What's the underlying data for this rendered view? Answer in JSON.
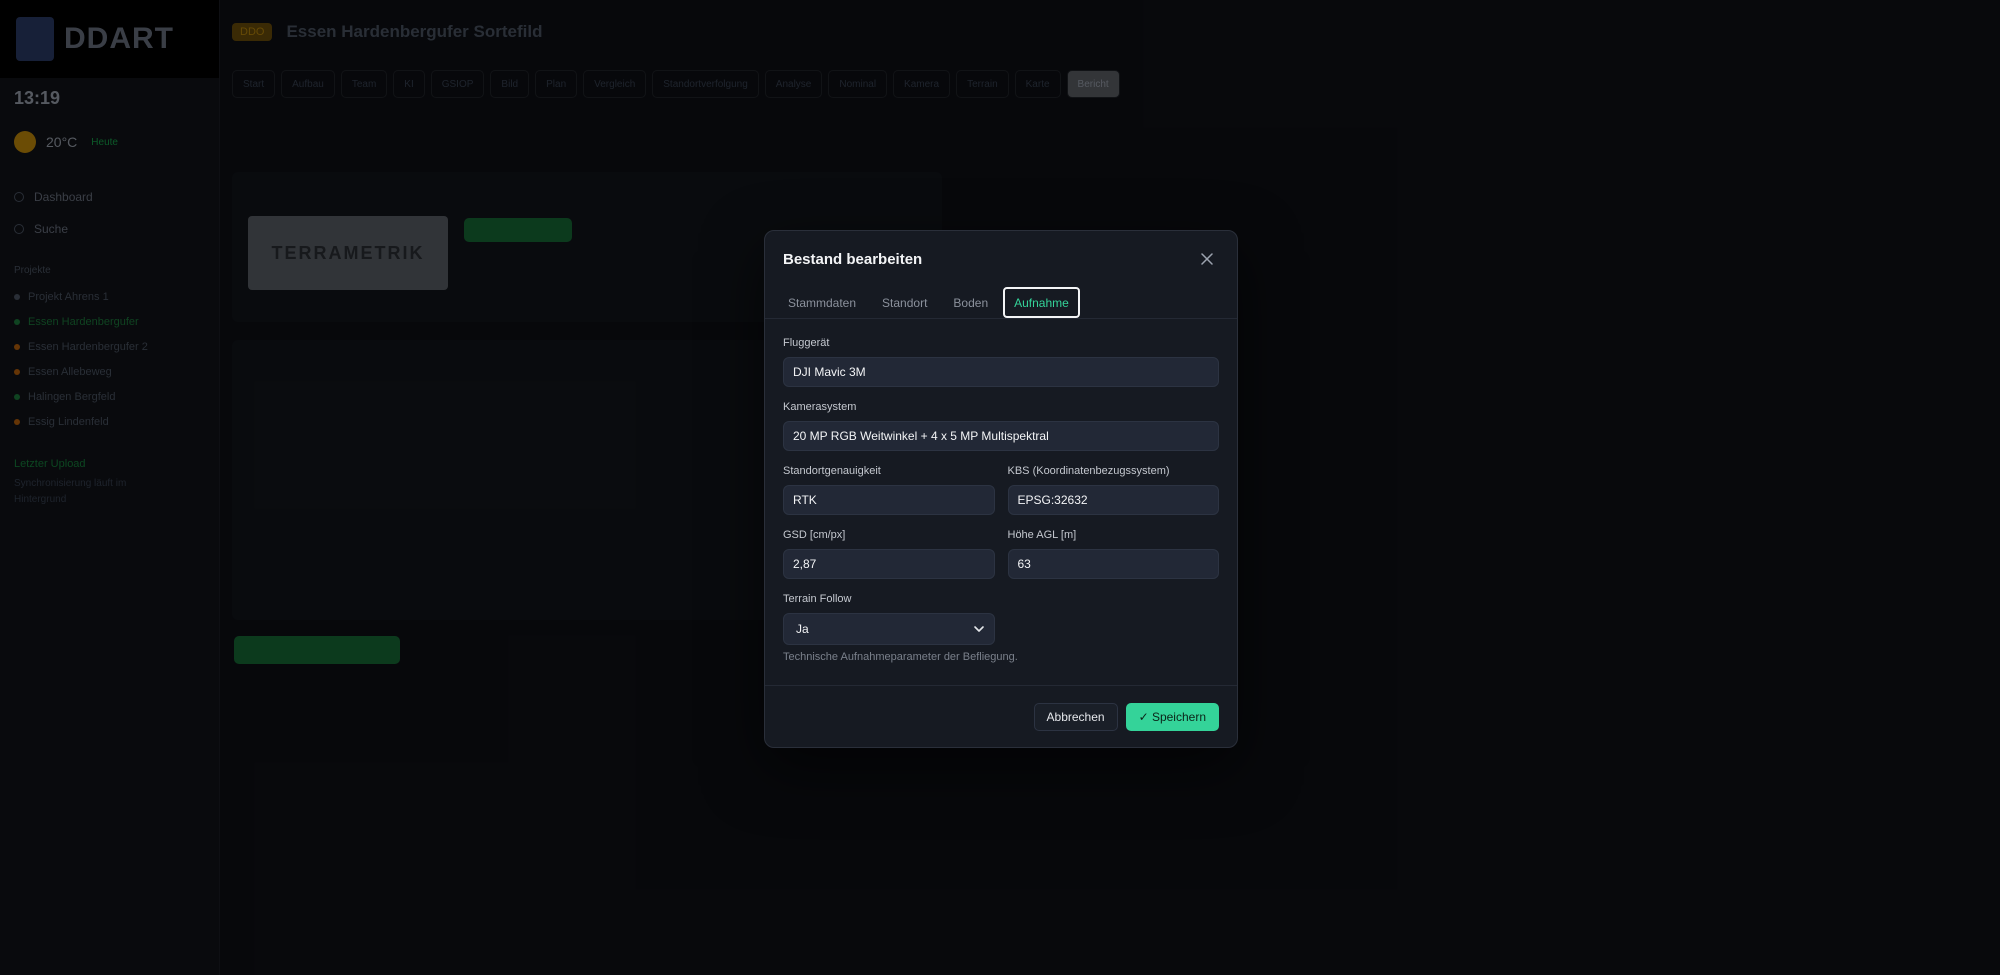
{
  "sidebar": {
    "brand": "DDART",
    "clock": "13:19",
    "weather": {
      "temp": "20°C",
      "sub": "Heute"
    },
    "nav": [
      "Dashboard",
      "Suche"
    ],
    "section": "Projekte",
    "projects": [
      {
        "label": "Projekt Ahrens 1",
        "color": "#4b5563"
      },
      {
        "label": "Essen Hardenbergufer",
        "color": "#1c7a3c",
        "active": true
      },
      {
        "label": "Essen Hardenbergufer 2",
        "color": "#b8610b"
      },
      {
        "label": "Essen Allebeweg",
        "color": "#b8610b"
      },
      {
        "label": "Halingen Bergfeld",
        "color": "#1c7a3c"
      },
      {
        "label": "Essig Lindenfeld",
        "color": "#b8610b"
      }
    ],
    "status_title": "Letzter Upload",
    "status_text": "Synchronisierung läuft im Hintergrund"
  },
  "main": {
    "badge": "DDO",
    "title": "Essen Hardenbergufer Sortefild",
    "tabs": [
      "Start",
      "Aufbau",
      "Team",
      "KI",
      "GSIOP",
      "Bild",
      "Plan",
      "Vergleich",
      "Standortverfolgung",
      "Analyse",
      "Nominal",
      "Kamera",
      "Terrain",
      "Karte",
      "Bericht"
    ],
    "logo_text": "TERRAMETRIK"
  },
  "modal": {
    "title": "Bestand bearbeiten",
    "tabs": [
      {
        "label": "Stammdaten",
        "active": false
      },
      {
        "label": "Standort",
        "active": false
      },
      {
        "label": "Boden",
        "active": false
      },
      {
        "label": "Aufnahme",
        "active": true
      }
    ],
    "fields": {
      "fluggeraet": {
        "label": "Fluggerät",
        "value": "DJI Mavic 3M"
      },
      "kamerasystem": {
        "label": "Kamerasystem",
        "value": "20 MP RGB Weitwinkel + 4 x 5 MP Multispektral"
      },
      "standortgenauigkeit": {
        "label": "Standortgenauigkeit",
        "value": "RTK"
      },
      "kbs": {
        "label": "KBS (Koordinatenbezugssystem)",
        "value": "EPSG:32632"
      },
      "gsd": {
        "label": "GSD [cm/px]",
        "value": "2,87"
      },
      "hoehe": {
        "label": "Höhe AGL [m]",
        "value": "63"
      },
      "terrain": {
        "label": "Terrain Follow",
        "value": "Ja"
      }
    },
    "hint": "Technische Aufnahmeparameter der Befliegung.",
    "cancel": "Abbrechen",
    "save": "✓ Speichern"
  }
}
